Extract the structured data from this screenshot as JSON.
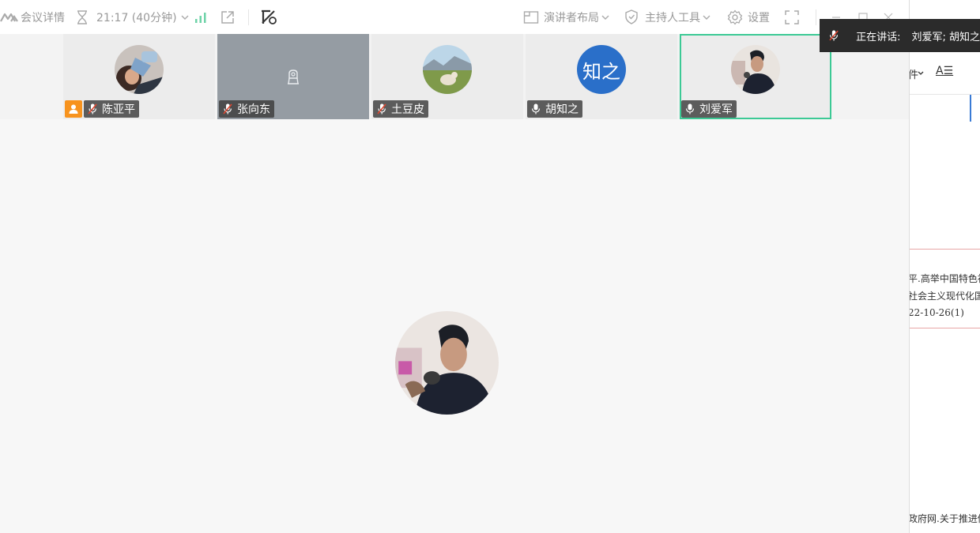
{
  "topbar": {
    "meeting_details": "会议详情",
    "timer": "21:17 (40分钟)",
    "speaker_layout": "演讲者布局",
    "host_tools": "主持人工具",
    "settings": "设置"
  },
  "participants": [
    {
      "name": "陈亚平",
      "muted": true,
      "host": true
    },
    {
      "name": "张向东",
      "muted": true,
      "host": false
    },
    {
      "name": "土豆皮",
      "muted": true,
      "host": false
    },
    {
      "name": "胡知之",
      "muted": false,
      "host": false,
      "avatar_text": "知之"
    },
    {
      "name": "刘爱军",
      "muted": false,
      "host": false,
      "active": true
    }
  ],
  "speaking": {
    "label": "正在讲话:",
    "names": "刘爱军; 胡知之"
  },
  "side": {
    "font_button": "A☰",
    "line1": "平.高举中国特色社",
    "line2": "社会主义现代化国",
    "line3": "22-10-26(1)",
    "line4": "政府网.关于推进促",
    "partial_char": "件"
  },
  "colors": {
    "active_border": "#3cc995",
    "host_badge": "#f7931e",
    "text_avatar": "#2a6fc9"
  }
}
